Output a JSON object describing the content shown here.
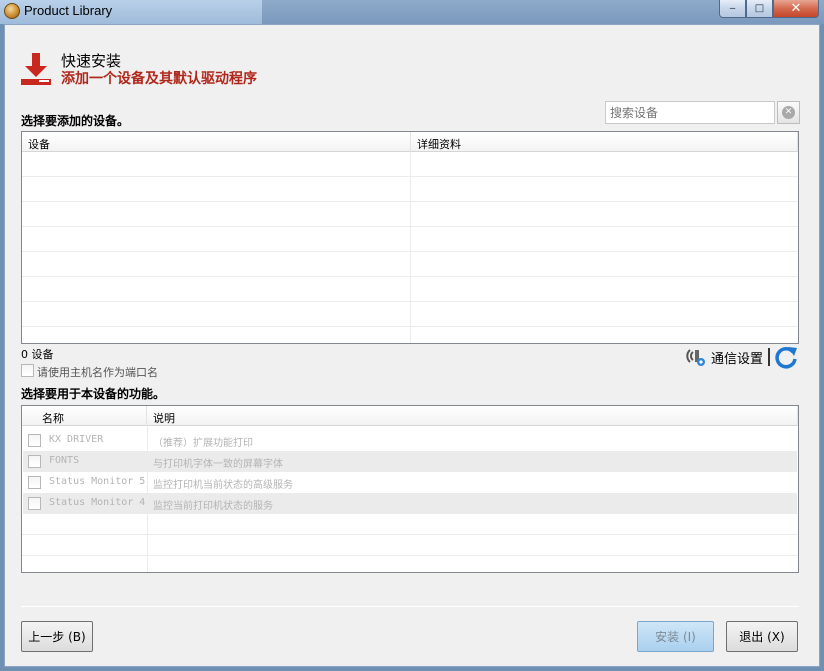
{
  "window": {
    "title": "Product Library",
    "minimize": "‒",
    "maximize": "□",
    "close": "✕"
  },
  "header": {
    "title": "快速安装",
    "subtitle": "添加一个设备及其默认驱动程序"
  },
  "devices": {
    "section_label": "选择要添加的设备。",
    "search_placeholder": "搜索设备",
    "columns": [
      "设备",
      "详细资料"
    ],
    "count_text": "0 设备",
    "use_hostname_label": "请使用主机名作为端口名"
  },
  "comm": {
    "settings_label": "通信设置"
  },
  "features": {
    "section_label": "选择要用于本设备的功能。",
    "columns": [
      "名称",
      "说明"
    ],
    "rows": [
      {
        "name": "KX DRIVER",
        "desc": "（推荐）扩展功能打印"
      },
      {
        "name": "FONTS",
        "desc": "与打印机字体一致的屏幕字体"
      },
      {
        "name": "Status Monitor 5",
        "desc": "监控打印机当前状态的高级服务"
      },
      {
        "name": "Status Monitor 4",
        "desc": "监控当前打印机状态的服务"
      }
    ]
  },
  "buttons": {
    "back": "上一步 (B)",
    "install": "安装 (I)",
    "exit": "退出 (X)"
  },
  "colors": {
    "accent_red": "#b0281c",
    "refresh_blue": "#1e78d2"
  }
}
